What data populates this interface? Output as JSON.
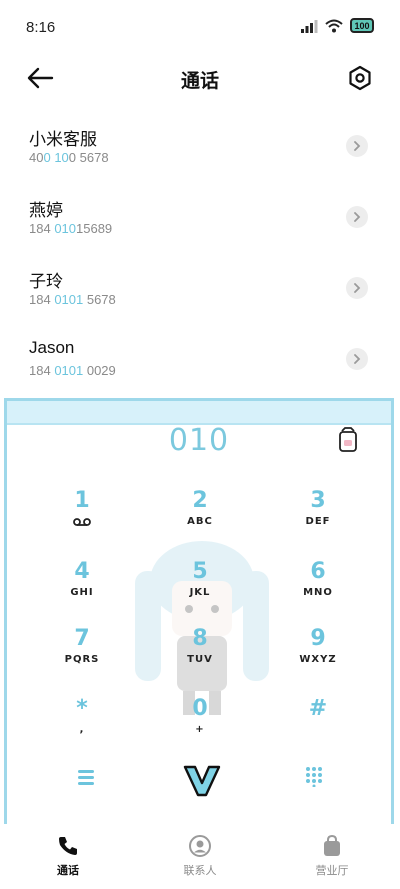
{
  "status_bar": {
    "time": "8:16",
    "battery": "100",
    "icons": [
      "signal-icon",
      "wifi-icon",
      "battery-icon"
    ]
  },
  "header": {
    "title": "通话",
    "back_icon": "arrow-left-icon",
    "settings_icon": "settings-icon"
  },
  "contacts": [
    {
      "name": "小米客服",
      "number_parts": [
        "40",
        "0",
        " ",
        "10",
        "0 5678"
      ]
    },
    {
      "name": "燕婷",
      "number_parts": [
        "184 ",
        "010",
        "15689"
      ]
    },
    {
      "name": "子玲",
      "number_parts": [
        "184 ",
        "0101",
        " 5678"
      ]
    },
    {
      "name": "Jason",
      "number_parts": [
        "184 ",
        "0101",
        " 0029"
      ]
    }
  ],
  "dialpad": {
    "input_value": "010",
    "keys": [
      {
        "digit": "1",
        "letters": ""
      },
      {
        "digit": "2",
        "letters": "ABC"
      },
      {
        "digit": "3",
        "letters": "DEF"
      },
      {
        "digit": "4",
        "letters": "GHI"
      },
      {
        "digit": "5",
        "letters": "JKL"
      },
      {
        "digit": "6",
        "letters": "MNO"
      },
      {
        "digit": "7",
        "letters": "PQRS"
      },
      {
        "digit": "8",
        "letters": "TUV"
      },
      {
        "digit": "9",
        "letters": "WXYZ"
      },
      {
        "digit": "*",
        "letters": ","
      },
      {
        "digit": "0",
        "letters": "+"
      },
      {
        "digit": "#",
        "letters": ""
      }
    ]
  },
  "bottom_nav": [
    {
      "label": "通话",
      "icon": "phone-icon",
      "active": true
    },
    {
      "label": "联系人",
      "icon": "contact-icon",
      "active": false
    },
    {
      "label": "营业厅",
      "icon": "shopping-bag-icon",
      "active": false
    }
  ],
  "colors": {
    "accent": "#6cc4dd",
    "dialpad_border": "#9ed8ea",
    "dialpad_top": "#d7f1fa",
    "muted_text": "#8a8a8a"
  }
}
